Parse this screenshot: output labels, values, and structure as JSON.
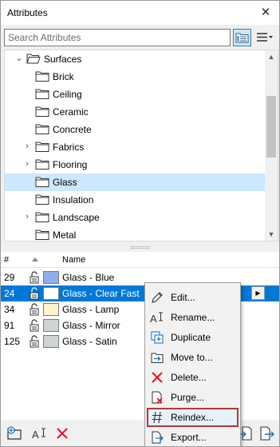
{
  "window": {
    "title": "Attributes"
  },
  "search": {
    "placeholder": "Search Attributes",
    "value": ""
  },
  "tree": {
    "parent": {
      "label": "Surfaces",
      "expanded": true
    },
    "items": [
      {
        "label": "Brick",
        "has_children": false,
        "selected": false
      },
      {
        "label": "Ceiling",
        "has_children": false,
        "selected": false
      },
      {
        "label": "Ceramic",
        "has_children": false,
        "selected": false
      },
      {
        "label": "Concrete",
        "has_children": false,
        "selected": false
      },
      {
        "label": "Fabrics",
        "has_children": true,
        "selected": false
      },
      {
        "label": "Flooring",
        "has_children": true,
        "selected": false
      },
      {
        "label": "Glass",
        "has_children": false,
        "selected": true
      },
      {
        "label": "Insulation",
        "has_children": false,
        "selected": false
      },
      {
        "label": "Landscape",
        "has_children": true,
        "selected": false
      },
      {
        "label": "Metal",
        "has_children": false,
        "selected": false
      }
    ]
  },
  "list": {
    "columns": {
      "index": "#",
      "name": "Name"
    },
    "rows": [
      {
        "index": "29",
        "name": "Glass - Blue",
        "color": "#90aee8",
        "selected": false
      },
      {
        "index": "24",
        "name": "Glass - Clear Fast",
        "color": "#ffffff",
        "selected": true
      },
      {
        "index": "34",
        "name": "Glass - Lamp",
        "color": "#fff4cc",
        "selected": false
      },
      {
        "index": "91",
        "name": "Glass - Mirror",
        "color": "#cfd3d3",
        "selected": false
      },
      {
        "index": "125",
        "name": "Glass - Satin",
        "color": "#cfd3d3",
        "selected": false
      }
    ]
  },
  "context_menu": {
    "items": [
      {
        "label": "Edit...",
        "icon": "pencil-icon"
      },
      {
        "label": "Rename...",
        "icon": "rename-icon"
      },
      {
        "label": "Duplicate",
        "icon": "duplicate-icon"
      },
      {
        "label": "Move to...",
        "icon": "move-to-icon"
      },
      {
        "label": "Delete...",
        "icon": "delete-x-icon"
      },
      {
        "label": "Purge...",
        "icon": "purge-icon"
      },
      {
        "label": "Reindex...",
        "icon": "hash-icon",
        "highlighted": true
      },
      {
        "label": "Export...",
        "icon": "export-icon"
      }
    ]
  },
  "colors": {
    "selection_blue": "#0078d7",
    "tree_selection": "#cce8ff",
    "highlight_outline": "#b03a3a",
    "delete_red": "#e81123",
    "icon_blue": "#1e73be"
  }
}
